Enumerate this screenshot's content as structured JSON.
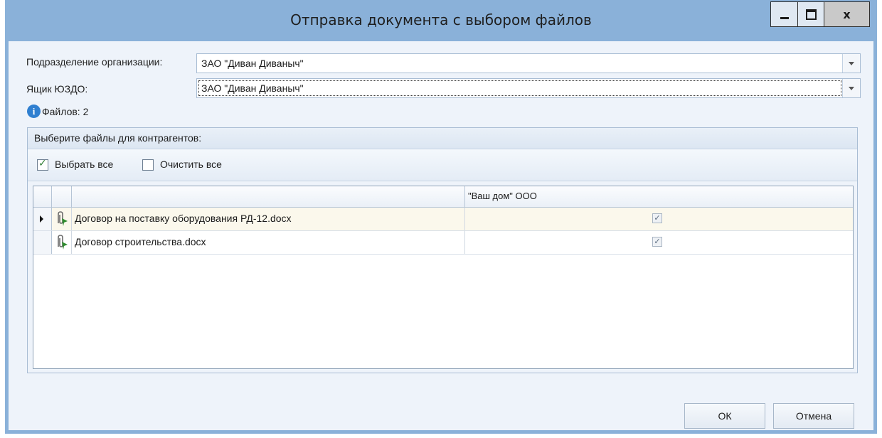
{
  "window": {
    "title": "Отправка документа с выбором файлов",
    "close_glyph": "x"
  },
  "form": {
    "org_label": "Подразделение организации:",
    "org_value": "ЗАО \"Диван Диваныч\"",
    "box_label": "Ящик ЮЗДО:",
    "box_value": "ЗАО \"Диван Диваныч\"",
    "files_count": "Файлов: 2"
  },
  "group": {
    "title": "Выберите файлы для контрагентов:",
    "select_all": "Выбрать все",
    "clear_all": "Очистить все",
    "select_all_checked": true,
    "clear_all_checked": false
  },
  "grid": {
    "column_header": "\"Ваш дом\" ООО",
    "rows": [
      {
        "name": "Договор на поставку оборудования РД-12.docx",
        "checked": true,
        "current": true
      },
      {
        "name": "Договор строительства.docx",
        "checked": true,
        "current": false
      }
    ]
  },
  "buttons": {
    "ok": "ОК",
    "cancel": "Отмена"
  },
  "icons": [
    "info-icon",
    "attachment-icon",
    "row-pointer-icon",
    "dropdown-arrow-icon",
    "minimize-icon",
    "maximize-icon",
    "close-icon"
  ]
}
